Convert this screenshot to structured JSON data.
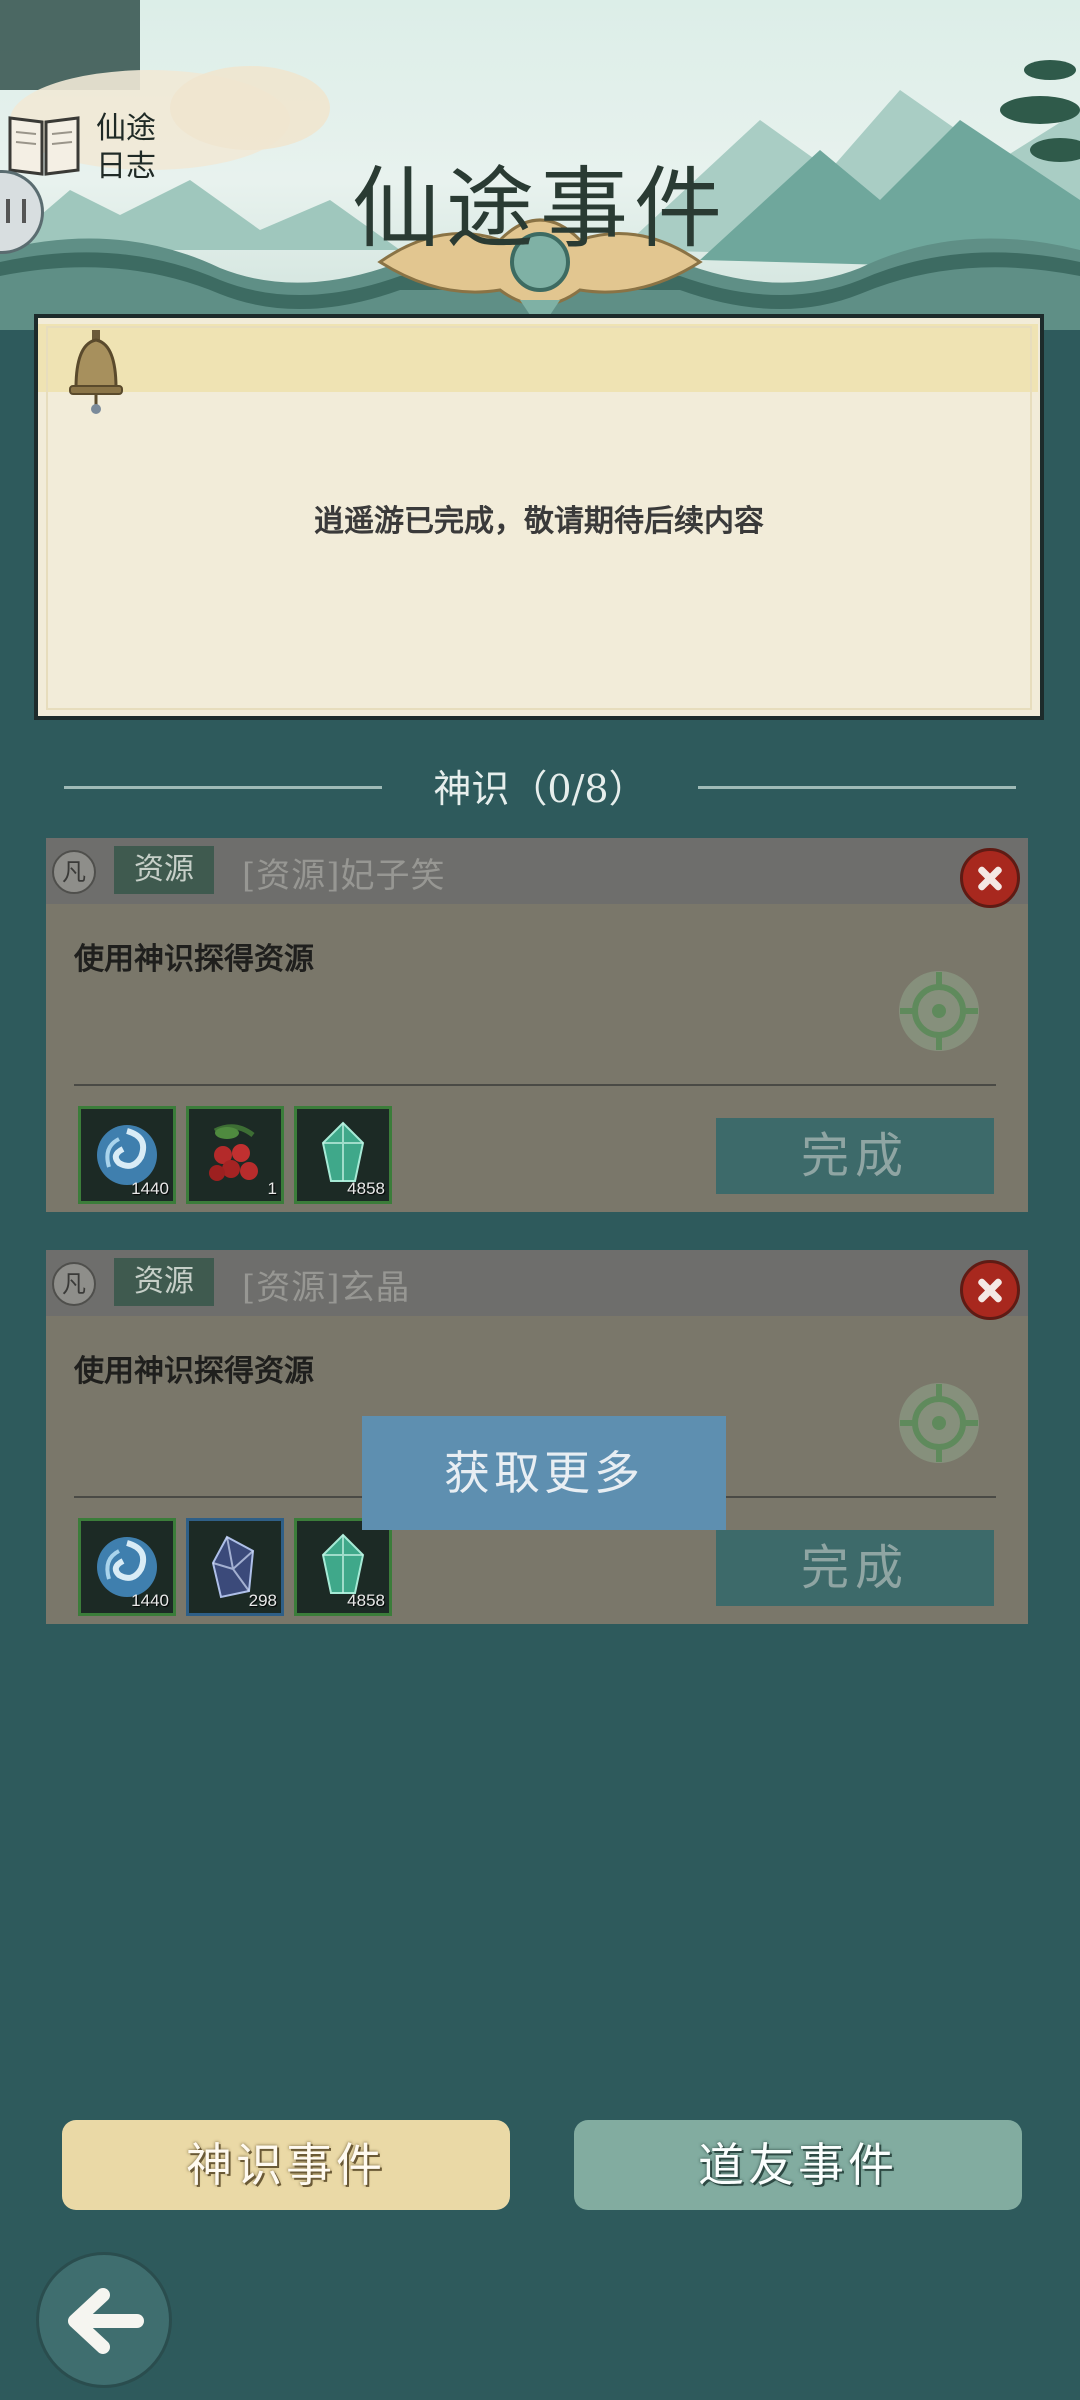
{
  "header": {
    "title": "仙途事件",
    "journal_label_line1": "仙途",
    "journal_label_line2": "日志"
  },
  "notice": {
    "text": "逍遥游已完成，敬请期待后续内容"
  },
  "section": {
    "title": "神识（0/8）"
  },
  "events": [
    {
      "rank": "凡",
      "type": "资源",
      "name": "[资源]妃子笑",
      "description": "使用神识探得资源",
      "rewards": [
        {
          "icon": "swirl-orb-icon",
          "count": "1440"
        },
        {
          "icon": "red-berries-icon",
          "count": "1"
        },
        {
          "icon": "green-crystal-icon",
          "count": "4858"
        }
      ],
      "complete_label": "完成"
    },
    {
      "rank": "凡",
      "type": "资源",
      "name": "[资源]玄晶",
      "description": "使用神识探得资源",
      "rewards": [
        {
          "icon": "swirl-orb-icon",
          "count": "1440"
        },
        {
          "icon": "dark-crystal-icon",
          "count": "298"
        },
        {
          "icon": "green-crystal-icon",
          "count": "4858"
        }
      ],
      "complete_label": "完成"
    }
  ],
  "toast": {
    "text": "获取更多"
  },
  "bottom_tabs": {
    "spirit_events": "神识事件",
    "friend_events": "道友事件"
  },
  "colors": {
    "background": "#2e5a5c",
    "board": "#f2ecd9",
    "close": "#a8281e",
    "toast": "#5e8fb0"
  }
}
